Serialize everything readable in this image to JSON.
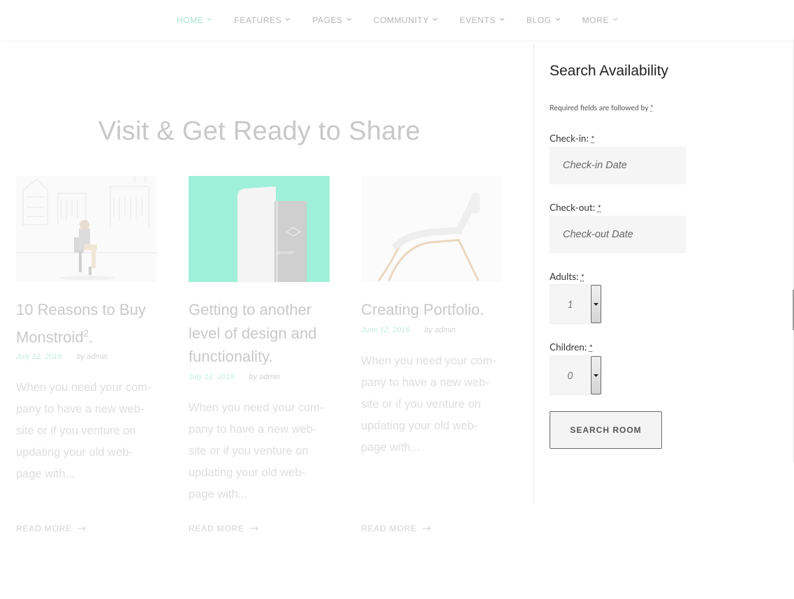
{
  "nav": {
    "items": [
      {
        "label": "HOME",
        "active": true
      },
      {
        "label": "FEATURES"
      },
      {
        "label": "PAGES"
      },
      {
        "label": "COMMUNITY"
      },
      {
        "label": "EVENTS"
      },
      {
        "label": "BLOG"
      },
      {
        "label": "MORE"
      }
    ]
  },
  "main": {
    "heading": "Visit & Get Ready to Share",
    "posts": [
      {
        "title": "10 Reasons to Buy Monstroid",
        "title_sup": "2",
        "title_suffix": ".",
        "date": "July 12, 2016",
        "author": "by admin",
        "excerpt": "When you need your com-pany to have a new web-site or if you venture on updating your old web-page with...",
        "read_more": "READ MORE"
      },
      {
        "title": "Getting to another level of design and functionality.",
        "date": "July 12, 2016",
        "author": "by admin",
        "excerpt": "When you need your com-pany to have a new web-site or if you venture on updating your old web-page with...",
        "read_more": "READ MORE",
        "image_text": "Monster"
      },
      {
        "title": "Creating Portfolio.",
        "date": "June 12, 2016",
        "author": "by admin",
        "excerpt": "When you need your com-pany to have a new web-site or if you venture on updating your old web-page with...",
        "read_more": "READ MORE"
      }
    ]
  },
  "sidebar": {
    "title": "Search Availability",
    "required_note": "Required fields are followed by",
    "required_star": "*",
    "checkin_label": "Check-in:",
    "checkin_placeholder": "Check-in Date",
    "checkout_label": "Check-out:",
    "checkout_placeholder": "Check-out Date",
    "adults_label": "Adults:",
    "adults_value": "1",
    "children_label": "Children:",
    "children_value": "0",
    "search_button": "SEARCH ROOM"
  },
  "colors": {
    "accent": "#a9e6d4",
    "muted_text": "#c9c9c9"
  }
}
